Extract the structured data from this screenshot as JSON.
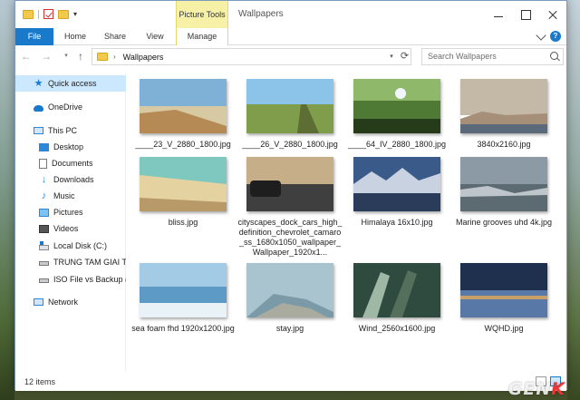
{
  "window": {
    "title": "Wallpapers",
    "context_tab_header": "Picture Tools"
  },
  "ribbon": {
    "tabs": [
      "File",
      "Home",
      "Share",
      "View",
      "Manage"
    ],
    "help": "?"
  },
  "nav": {
    "back": "←",
    "forward": "→",
    "recent": "▾",
    "up": "↑",
    "address_arrow": "›",
    "address_path": "Wallpapers",
    "refresh": "⟳",
    "address_drop": "▾",
    "search_placeholder": "Search Wallpapers"
  },
  "sidebar": {
    "items": [
      {
        "label": "Quick access",
        "icon": "star-icon"
      },
      {
        "label": "OneDrive",
        "icon": "cloud-icon"
      },
      {
        "label": "This PC",
        "icon": "computer-icon"
      },
      {
        "label": "Desktop",
        "icon": "desktop-icon"
      },
      {
        "label": "Documents",
        "icon": "documents-icon"
      },
      {
        "label": "Downloads",
        "icon": "downloads-icon"
      },
      {
        "label": "Music",
        "icon": "music-icon"
      },
      {
        "label": "Pictures",
        "icon": "pictures-icon"
      },
      {
        "label": "Videos",
        "icon": "videos-icon"
      },
      {
        "label": "Local Disk (C:)",
        "icon": "disk-icon"
      },
      {
        "label": "TRUNG TAM GIAI T",
        "icon": "usb-drive-icon"
      },
      {
        "label": "ISO File vs Backup (",
        "icon": "usb-drive-icon"
      },
      {
        "label": "Network",
        "icon": "network-icon"
      }
    ]
  },
  "files": [
    {
      "name": "____23_V_2880_1800.jpg",
      "colors": [
        "#7fb0d6",
        "#d7c9a2",
        "#b58a55"
      ]
    },
    {
      "name": "____26_V_2880_1800.jpg",
      "colors": [
        "#8cc3e8",
        "#7f9d4a",
        "#5c6e33"
      ]
    },
    {
      "name": "____64_IV_2880_1800.jpg",
      "colors": [
        "#9fc878",
        "#4f7a35",
        "#253b1a"
      ]
    },
    {
      "name": "3840x2160.jpg",
      "colors": [
        "#c4b8a6",
        "#a58f78",
        "#5a6a7a"
      ]
    },
    {
      "name": "bliss.jpg",
      "colors": [
        "#7fc8c0",
        "#e4d3a0",
        "#b89a68"
      ]
    },
    {
      "name": "cityscapes_dock_cars_high_definition_chevrolet_camaro_ss_1680x1050_wallpaper_Wallpaper_1920x1...",
      "colors": [
        "#c6ae88",
        "#3f3f3f",
        "#1e1e1e"
      ]
    },
    {
      "name": "Himalaya 16x10.jpg",
      "colors": [
        "#3a5a8a",
        "#c9d2e0",
        "#2b3b5a"
      ]
    },
    {
      "name": "Marine grooves uhd 4k.jpg",
      "colors": [
        "#8c9aa6",
        "#5c6a72",
        "#e8eef2"
      ]
    },
    {
      "name": "sea foam fhd 1920x1200.jpg",
      "colors": [
        "#a4cbe6",
        "#5d9bc6",
        "#e9f2f7"
      ]
    },
    {
      "name": "stay.jpg",
      "colors": [
        "#a9c4cf",
        "#7a9aa8",
        "#c8b89a"
      ]
    },
    {
      "name": "Wind_2560x1600.jpg",
      "colors": [
        "#2f4a3e",
        "#9fb7a5",
        "#54705c"
      ]
    },
    {
      "name": "WQHD.jpg",
      "colors": [
        "#1f2f4e",
        "#5878a8",
        "#c8a068"
      ]
    }
  ],
  "status": {
    "item_count": "12 items"
  },
  "watermark": {
    "text_main": "GEN",
    "text_k": "K"
  }
}
